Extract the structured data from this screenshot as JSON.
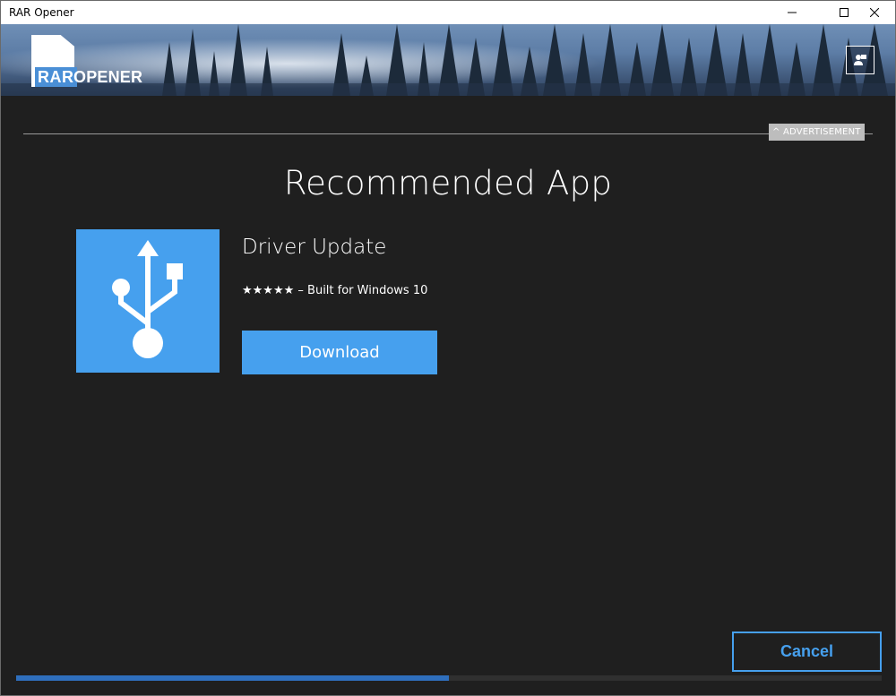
{
  "window": {
    "title": "RAR Opener",
    "controls": [
      "minimize-icon",
      "maximize-icon",
      "close-icon"
    ]
  },
  "header": {
    "logo_rar": "RAR",
    "logo_opener": "OPENER",
    "feedback_icon": "feedback-person-icon"
  },
  "ad": {
    "tag_label": "^ ADVERTISEMENT"
  },
  "main": {
    "heading": "Recommended App",
    "app": {
      "name": "Driver Update",
      "meta": "★★★★★ – Built for Windows 10",
      "icon": "usb-icon",
      "download_label": "Download"
    }
  },
  "footer": {
    "cancel_label": "Cancel",
    "progress": 0.5
  },
  "colors": {
    "accent": "#46a0ee",
    "background": "#1f1f1f",
    "progress_fill": "#2f6fbd"
  }
}
